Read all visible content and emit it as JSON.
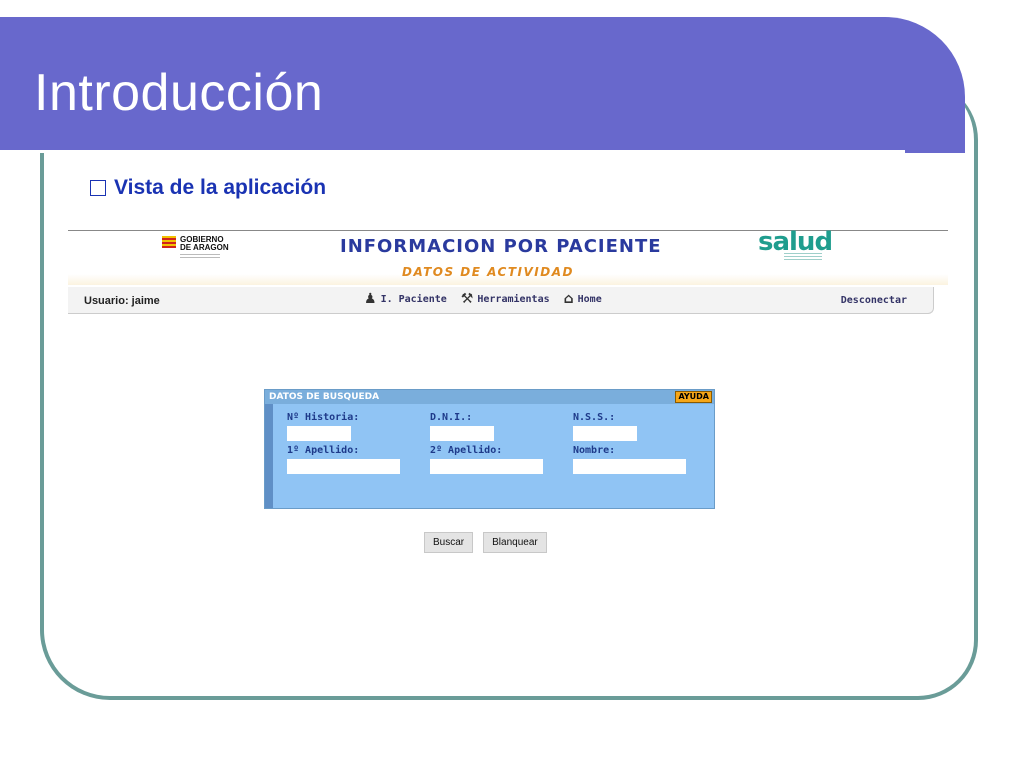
{
  "slide": {
    "title": "Introducción",
    "bullet_heading": "Vista de la aplicación",
    "colors": {
      "banner": "#6868cc",
      "frame": "#6a9c98",
      "heading": "#1a33b3"
    }
  },
  "app": {
    "gov_logo": {
      "line1": "GOBIERNO",
      "line2": "DE ARAGON",
      "icon": "flag-icon"
    },
    "main_title": "INFORMACION POR PACIENTE",
    "sub_title": "DATOS DE ACTIVIDAD",
    "salud_logo": "salud",
    "nav": {
      "user_label": "Usuario: jaime",
      "links": [
        {
          "label": "I. Paciente",
          "icon": "user-icon"
        },
        {
          "label": "Herramientas",
          "icon": "wrench-icon"
        },
        {
          "label": "Home",
          "icon": "home-icon"
        }
      ],
      "logout_label": "Desconectar"
    },
    "search": {
      "header": "DATOS DE BUSQUEDA",
      "help_label": "AYUDA",
      "fields": [
        {
          "label": "Nº Historia:",
          "value": ""
        },
        {
          "label": "D.N.I.:",
          "value": ""
        },
        {
          "label": "N.S.S.:",
          "value": ""
        },
        {
          "label": "1º Apellido:",
          "value": ""
        },
        {
          "label": "2º Apellido:",
          "value": ""
        },
        {
          "label": "Nombre:",
          "value": ""
        }
      ]
    },
    "buttons": {
      "search_label": "Buscar",
      "clear_label": "Blanquear"
    }
  }
}
